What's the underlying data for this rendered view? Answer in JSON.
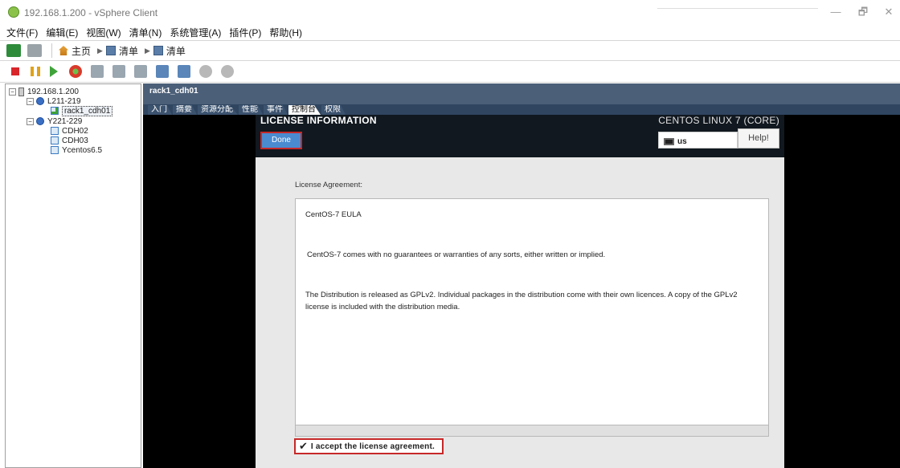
{
  "window": {
    "title": "192.168.1.200 - vSphere Client",
    "minimize": "—",
    "restore": "🗗",
    "close": "✕"
  },
  "menu": [
    "文件(F)",
    "编辑(E)",
    "视图(W)",
    "清单(N)",
    "系统管理(A)",
    "插件(P)",
    "帮助(H)"
  ],
  "nav": {
    "home": "主页",
    "inventory1": "清单",
    "inventory2": "清单"
  },
  "tree": {
    "host": "192.168.1.200",
    "dc1": "L211-219",
    "vm_selected": "rack1_cdh01",
    "dc2": "Y221-229",
    "vm2": "CDH02",
    "vm3": "CDH03",
    "vm4": "Ycentos6.5"
  },
  "vm": {
    "name": "rack1_cdh01",
    "tabs": [
      "入门",
      "摘要",
      "资源分配",
      "性能",
      "事件",
      "控制台",
      "权限"
    ],
    "active_tab": "控制台"
  },
  "installer": {
    "title": "LICENSE INFORMATION",
    "product": "CENTOS LINUX 7 (CORE)",
    "done": "Done",
    "keyboard": "us",
    "help": "Help!",
    "license_label": "License Agreement:",
    "eula_title": "CentOS-7 EULA",
    "para1": "CentOS-7 comes with no guarantees or warranties of any sorts, either written or implied.",
    "para2": "The Distribution is released as GPLv2. Individual packages in the distribution come with their own licences. A copy of the GPLv2 license is included with the distribution media.",
    "accept_label": "I accept the license agreement.",
    "accept_checked": true
  },
  "colors": {
    "header_blue": "#4b5f78",
    "done_blue": "#4a8bd0",
    "highlight_red": "#c62828"
  }
}
